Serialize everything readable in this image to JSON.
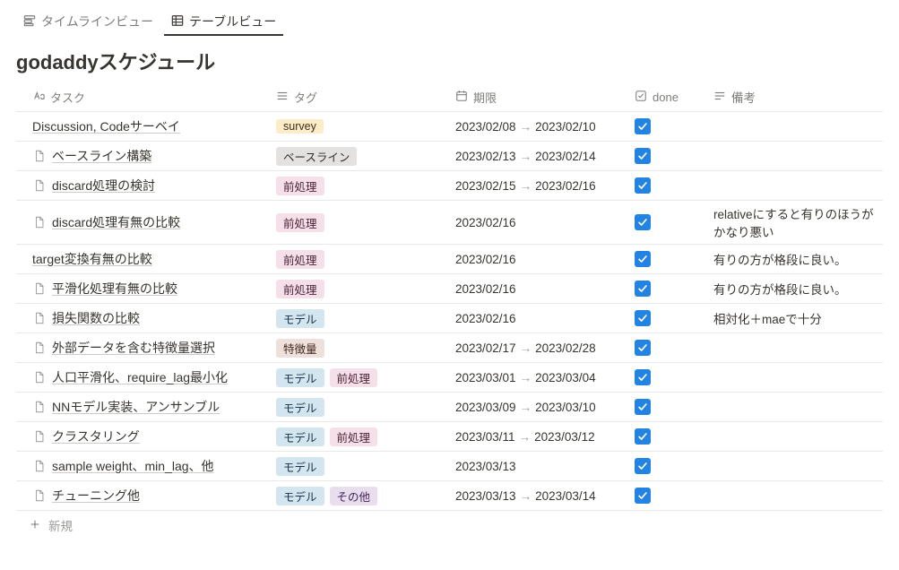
{
  "views": {
    "timeline": "タイムラインビュー",
    "table": "テーブルビュー"
  },
  "title": "godaddyスケジュール",
  "columns": {
    "task": "タスク",
    "tag": "タグ",
    "date": "期限",
    "done": "done",
    "note": "備考"
  },
  "tag_labels": {
    "survey": "survey",
    "baseline": "ベースライン",
    "pre": "前処理",
    "model": "モデル",
    "feature": "特徴量",
    "other": "その他"
  },
  "rows": [
    {
      "icon": false,
      "title": "Discussion, Codeサーベイ",
      "tags": [
        "survey"
      ],
      "start": "2023/02/08",
      "end": "2023/02/10",
      "done": true,
      "note": ""
    },
    {
      "icon": true,
      "title": "ベースライン構築",
      "tags": [
        "baseline"
      ],
      "start": "2023/02/13",
      "end": "2023/02/14",
      "done": true,
      "note": ""
    },
    {
      "icon": true,
      "title": "discard処理の検討",
      "tags": [
        "pre"
      ],
      "start": "2023/02/15",
      "end": "2023/02/16",
      "done": true,
      "note": ""
    },
    {
      "icon": true,
      "title": "discard処理有無の比較",
      "tags": [
        "pre"
      ],
      "start": "2023/02/16",
      "end": "",
      "done": true,
      "note": "relativeにすると有りのほうがかなり悪い"
    },
    {
      "icon": false,
      "title": "target変換有無の比較",
      "tags": [
        "pre"
      ],
      "start": "2023/02/16",
      "end": "",
      "done": true,
      "note": "有りの方が格段に良い。"
    },
    {
      "icon": true,
      "title": "平滑化処理有無の比較",
      "tags": [
        "pre"
      ],
      "start": "2023/02/16",
      "end": "",
      "done": true,
      "note": "有りの方が格段に良い。"
    },
    {
      "icon": true,
      "title": "損失関数の比較",
      "tags": [
        "model"
      ],
      "start": "2023/02/16",
      "end": "",
      "done": true,
      "note": "相対化＋maeで十分"
    },
    {
      "icon": true,
      "title": "外部データを含む特徴量選択",
      "tags": [
        "feature"
      ],
      "start": "2023/02/17",
      "end": "2023/02/28",
      "done": true,
      "note": ""
    },
    {
      "icon": true,
      "title": "人口平滑化、require_lag最小化",
      "tags": [
        "model",
        "pre"
      ],
      "start": "2023/03/01",
      "end": "2023/03/04",
      "done": true,
      "note": ""
    },
    {
      "icon": true,
      "title": "NNモデル実装、アンサンブル",
      "tags": [
        "model"
      ],
      "start": "2023/03/09",
      "end": "2023/03/10",
      "done": true,
      "note": ""
    },
    {
      "icon": true,
      "title": "クラスタリング",
      "tags": [
        "model",
        "pre"
      ],
      "start": "2023/03/11",
      "end": "2023/03/12",
      "done": true,
      "note": ""
    },
    {
      "icon": true,
      "title": "sample weight、min_lag、他",
      "tags": [
        "model"
      ],
      "start": "2023/03/13",
      "end": "",
      "done": true,
      "note": ""
    },
    {
      "icon": true,
      "title": "チューニング他",
      "tags": [
        "model",
        "other"
      ],
      "start": "2023/03/13",
      "end": "2023/03/14",
      "done": true,
      "note": ""
    }
  ],
  "new_label": "新規"
}
